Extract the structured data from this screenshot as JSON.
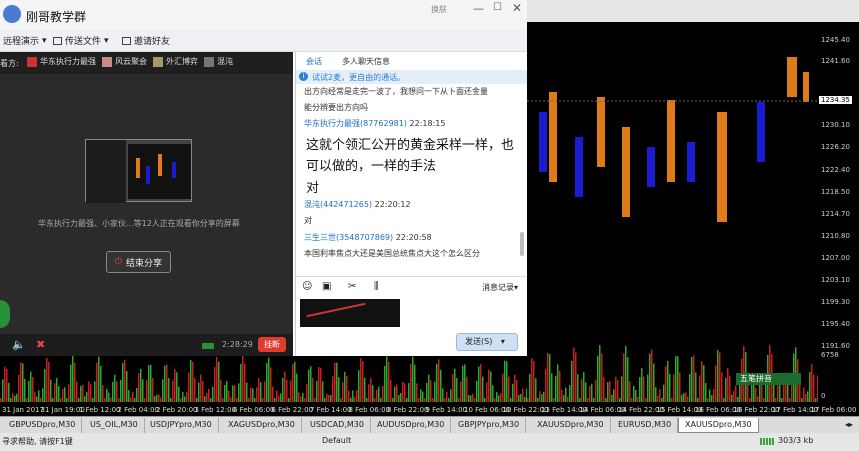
{
  "window": {
    "title": "刚哥教学群",
    "buttons": {
      "theme": "换肤"
    }
  },
  "toolbar": {
    "remote": "远程演示",
    "send_file": "传送文件",
    "invite": "邀请好友"
  },
  "share": {
    "viewers_label": "看方:",
    "viewers": [
      "华东执行力最强",
      "风云聚会",
      "外汇博弈",
      "混沌"
    ],
    "watching_text": "华东执行力最强、小家伙...等12人正在观看你分享的屏幕",
    "end_share": "结束分享",
    "timer": "2:28:29",
    "hangup": "挂断"
  },
  "chat": {
    "tabs": [
      "会话",
      "多人聊天信息"
    ],
    "notice": "试试2麦，更自由的通话。",
    "messages": [
      {
        "text": "出方向经常是走完一波了，我想问一下从卜面还金量"
      },
      {
        "text": "能分辨要出方向吗"
      },
      {
        "sender": "华东执行力最强",
        "id": "(87762981)",
        "time": "22:18:15"
      },
      {
        "text": "这就个领汇公开的黄金采样一样，也"
      },
      {
        "text": "可以做的，一样的手法"
      },
      {
        "text": "对"
      },
      {
        "sender": "混沌",
        "id": "(442471265)",
        "time": "22:20:12"
      },
      {
        "text": "对"
      },
      {
        "sender": "三生三世",
        "id": "(3548707869)",
        "time": "22:20:58"
      },
      {
        "text": "本国利率焦点大还是美国总统焦点大这个怎么区分"
      }
    ],
    "history": "消息记录",
    "send": "发送(S)"
  },
  "chart": {
    "price_labels": [
      "1245.40",
      "1241.60",
      "1234.35",
      "1230.10",
      "1226.20",
      "1222.40",
      "1218.50",
      "1214.70",
      "1210.80",
      "1207.00",
      "1203.10",
      "1199.30",
      "1195.40",
      "1191.60",
      "6758",
      "0"
    ],
    "current_price": "1234.35",
    "time_labels": [
      "31 Jan 2017",
      "31 Jan 19:00",
      "1 Feb 12:00",
      "2 Feb 04:00",
      "2 Feb 20:00",
      "3 Feb 12:00",
      "6 Feb 06:00",
      "6 Feb 22:00",
      "7 Feb 14:00",
      "8 Feb 06:00",
      "8 Feb 22:00",
      "9 Feb 14:00",
      "10 Feb 06:00",
      "10 Feb 22:00",
      "13 Feb 14:00",
      "14 Feb 06:00",
      "14 Feb 22:00",
      "15 Feb 14:00",
      "16 Feb 06:00",
      "16 Feb 22:00",
      "17 Feb 14:00",
      "17 Feb 06:00"
    ],
    "ime": "五笔拼音"
  },
  "tabs": [
    "GBPUSDpro,M30",
    "US_OIL,M30",
    "USDJPYpro,M30",
    "XAGUSDpro,M30",
    "USDCAD,M30",
    "AUDUSDpro,M30",
    "GBPJPYpro,M30",
    "XAUUSDpro,M30",
    "EURUSD,M30",
    "XAUUSDpro,M30"
  ],
  "status": {
    "help": "寻求帮助, 请按F1键",
    "profile": "Default",
    "traffic": "303/3 kb"
  },
  "colors": {
    "up": "#e07b1a",
    "down": "#1b1bd0",
    "vol_up": "#2fa82f",
    "vol_down": "#c82020"
  }
}
